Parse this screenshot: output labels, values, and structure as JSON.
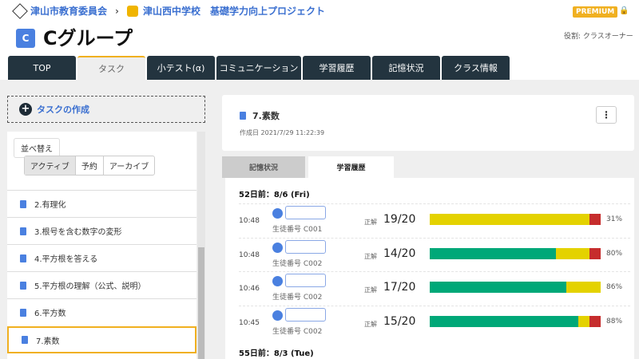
{
  "breadcrumb": {
    "org": "津山市教育委員会",
    "school": "津山西中学校　基礎学力向上プロジェクト"
  },
  "group": {
    "icon_letter": "C",
    "title": "Cグループ"
  },
  "premium": "PREMIUM",
  "role": "役割: クラスオーナー",
  "tabs": [
    "TOP",
    "タスク",
    "小テスト(α)",
    "コミュニケーション",
    "学習履歴",
    "記憶状況",
    "クラス情報"
  ],
  "create_task": "タスクの作成",
  "sort": "並べ替え",
  "filters": [
    "アクティブ",
    "予約",
    "アーカイブ"
  ],
  "tasks": [
    "2.有理化",
    "3.根号を含む数字の変形",
    "4.平方根を答える",
    "5.平方根の理解（公式、説明）",
    "6.平方数",
    "7.素数"
  ],
  "detail": {
    "name": "7.素数",
    "created": "作成日 2021/7/29 11:22:39",
    "more": "⋮"
  },
  "detail_tabs": [
    "記憶状況",
    "学習履歴"
  ],
  "days": [
    {
      "label": "52日前：8/6 (Fri)"
    },
    {
      "label": "55日前：8/3 (Tue)"
    }
  ],
  "correct_label": "正解",
  "colors": {
    "green": "#00a878",
    "yellow": "#e4d200",
    "red": "#c62d2d"
  },
  "records": [
    {
      "time": "10:48",
      "student": "生徒番号 C001",
      "score": "19/20",
      "pct": "31%",
      "bar": [
        0,
        93.5,
        6.5
      ]
    },
    {
      "time": "10:48",
      "student": "生徒番号 C002",
      "score": "14/20",
      "pct": "80%",
      "bar": [
        74,
        19.5,
        6.5
      ]
    },
    {
      "time": "10:46",
      "student": "生徒番号 C002",
      "score": "17/20",
      "pct": "86%",
      "bar": [
        80,
        20,
        0
      ]
    },
    {
      "time": "10:45",
      "student": "生徒番号 C002",
      "score": "15/20",
      "pct": "88%",
      "bar": [
        87,
        6.5,
        6.5
      ]
    }
  ]
}
